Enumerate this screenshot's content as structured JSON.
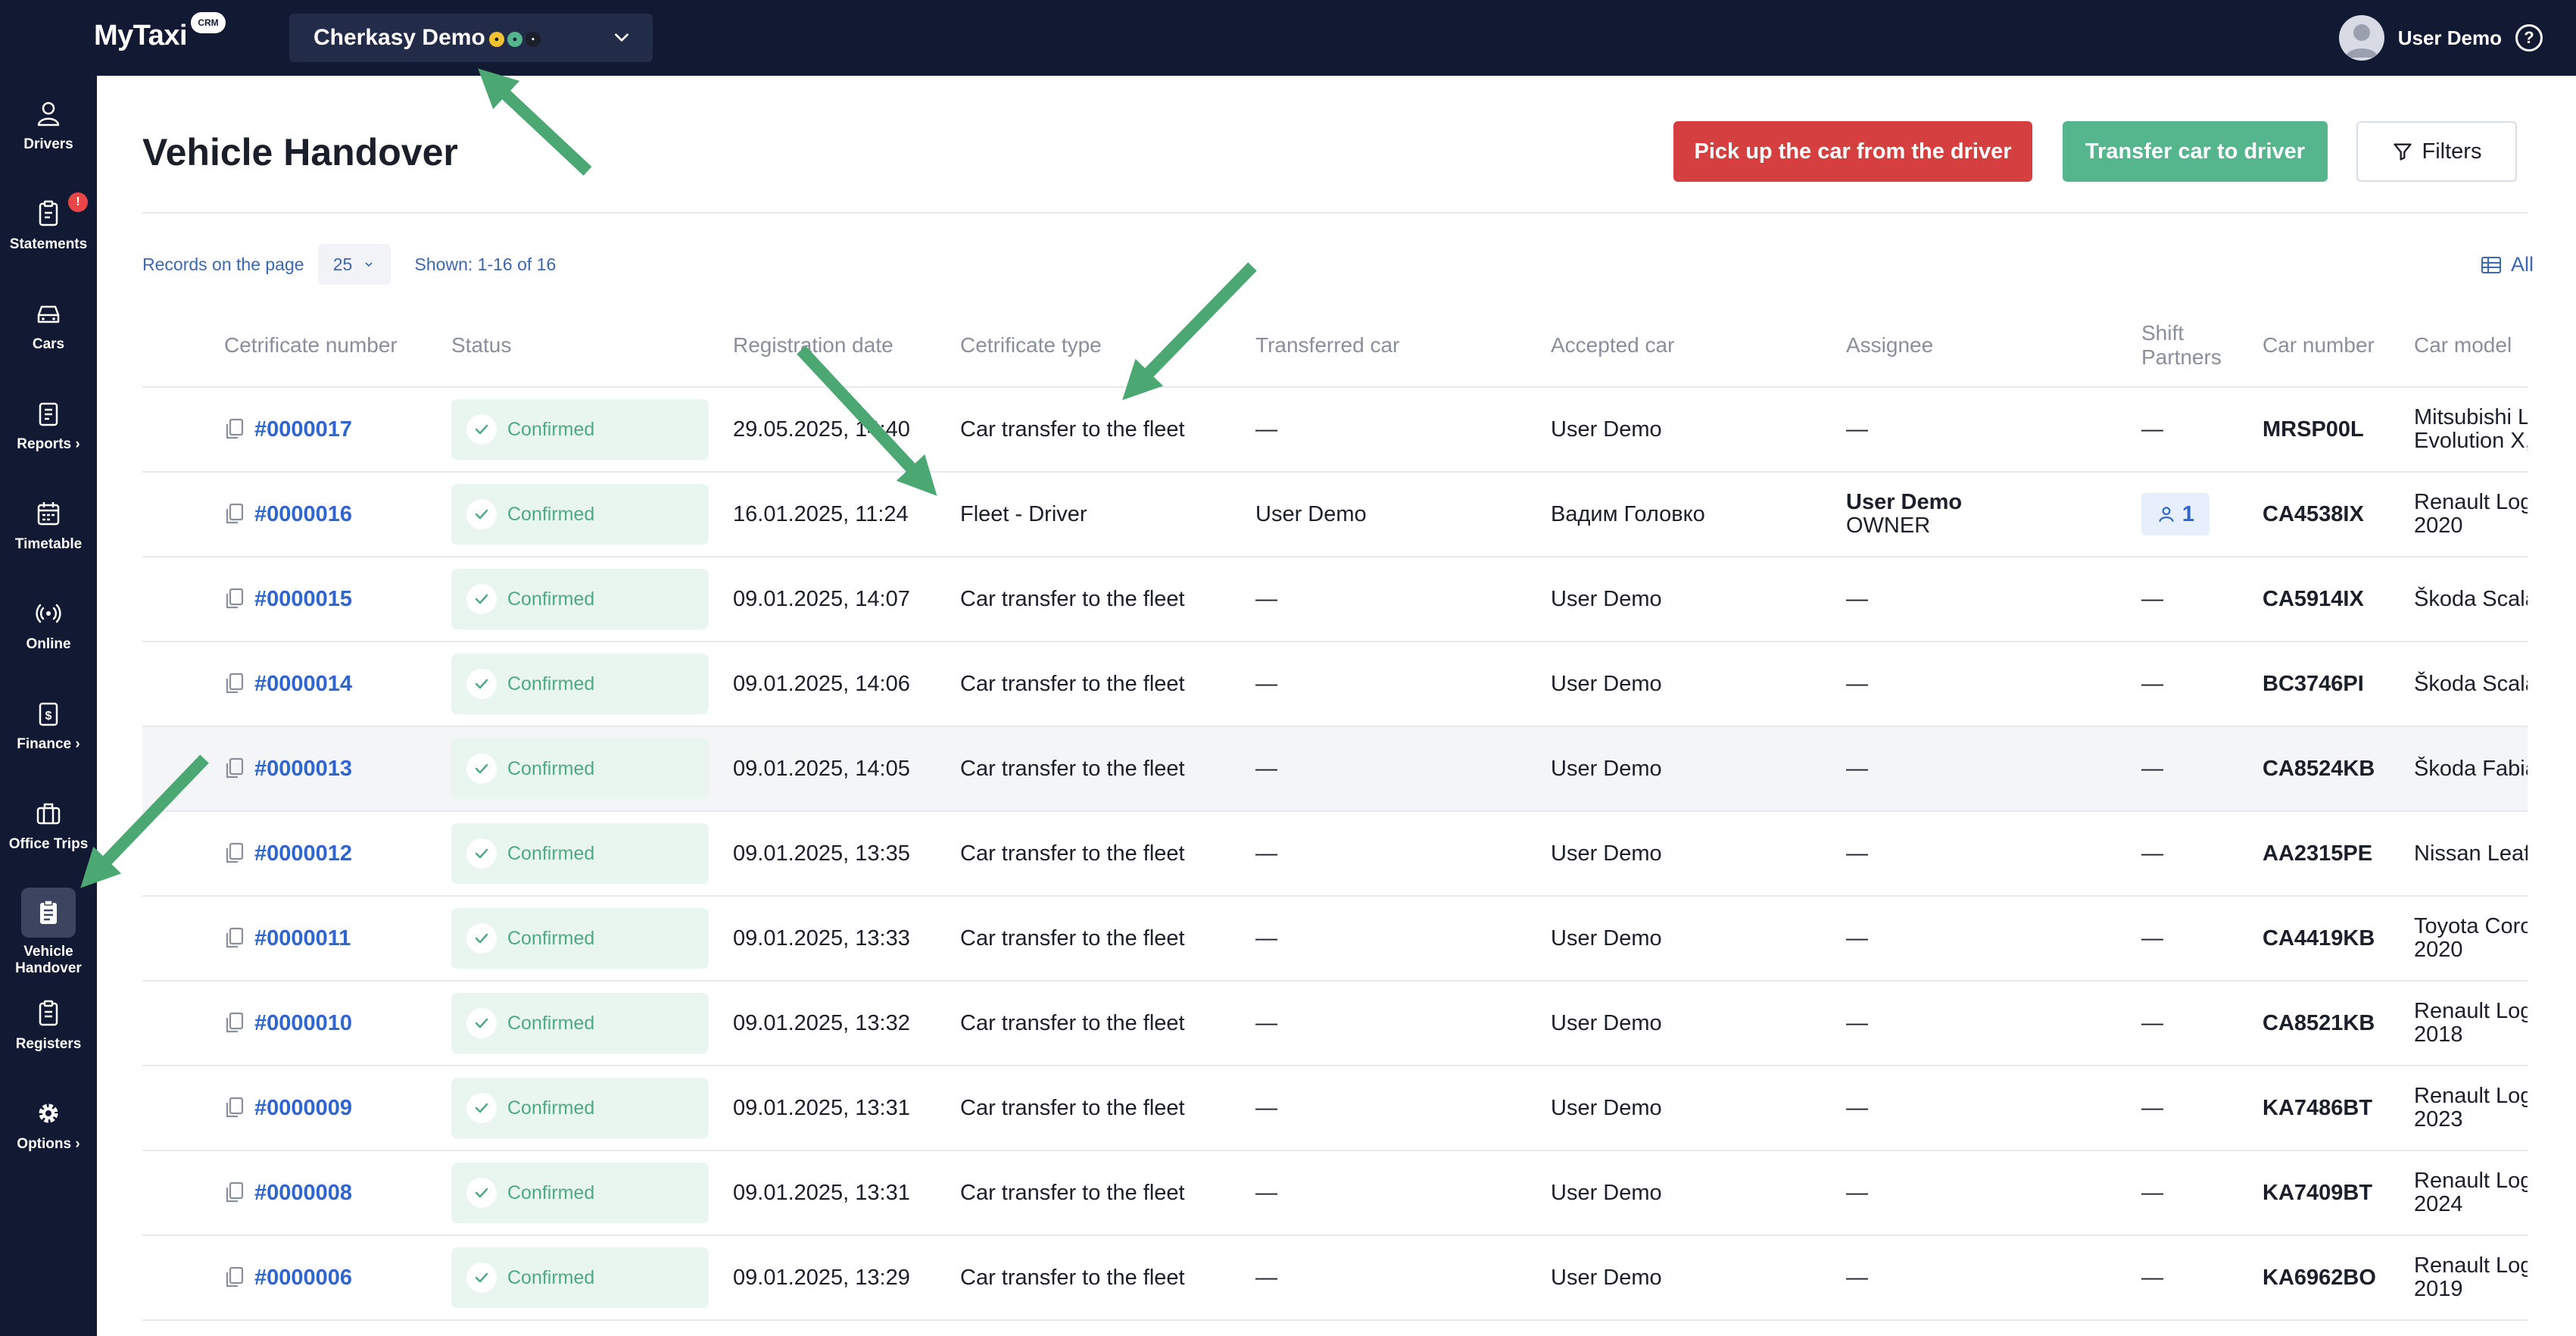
{
  "app": {
    "logo": "MyTaxi",
    "logo_badge": "CRM",
    "company": "Cherkasy Demo",
    "user": "User Demo",
    "help_glyph": "?"
  },
  "colors": {
    "sidebar_bg": "#121a33",
    "accent_blue": "#2f65cf",
    "danger": "#d63f3f",
    "success": "#55b58d",
    "arrow": "#4ca872"
  },
  "sidebar": {
    "items": [
      {
        "label": "Drivers",
        "icon": "person-icon"
      },
      {
        "label": "Statements",
        "icon": "clipboard-icon",
        "badge": "!"
      },
      {
        "label": "Cars",
        "icon": "car-icon"
      },
      {
        "label": "Reports ›",
        "icon": "report-icon"
      },
      {
        "label": "Timetable",
        "icon": "calendar-icon"
      },
      {
        "label": "Online",
        "icon": "broadcast-icon"
      },
      {
        "label": "Finance ›",
        "icon": "dollar-doc-icon"
      },
      {
        "label": "Office Trips",
        "icon": "briefcase-icon"
      },
      {
        "label": "Vehicle Handover",
        "icon": "handover-icon"
      },
      {
        "label": "Registers",
        "icon": "register-icon"
      },
      {
        "label": "Options ›",
        "icon": "gear-icon"
      }
    ]
  },
  "page": {
    "title": "Vehicle Handover",
    "btn_pickup": "Pick up the car from the driver",
    "btn_transfer": "Transfer car to driver",
    "btn_filters": "Filters",
    "records_label": "Records on the page",
    "per_page": "25",
    "shown": "Shown: 1-16 of 16",
    "all_link": "All"
  },
  "table": {
    "headers": {
      "cert_number": "Cetrificate number",
      "status": "Status",
      "reg_date": "Registration date",
      "cert_type": "Cetrificate type",
      "transferred": "Transferred car",
      "accepted": "Accepted car",
      "assignee": "Assignee",
      "shift_1": "Shift",
      "shift_2": "Partners",
      "car_number": "Car number",
      "car_model": "Car model"
    },
    "rows": [
      {
        "cert": "#0000017",
        "status": "Confirmed",
        "date": "29.05.2025, 14:40",
        "type": "Car transfer to the fleet",
        "transferred": "—",
        "accepted": "User Demo",
        "assignee": "—",
        "assignee_role": "",
        "partners": "—",
        "car": "MRSP00L",
        "model_1": "Mitsubishi L",
        "model_2": "Evolution X,"
      },
      {
        "cert": "#0000016",
        "status": "Confirmed",
        "date": "16.01.2025, 11:24",
        "type": "Fleet - Driver",
        "transferred": "User Demo",
        "accepted": "Вадим Головко",
        "assignee": "User Demo",
        "assignee_role": "OWNER",
        "partners": "1",
        "car": "CA4538IX",
        "model_1": "Renault Log",
        "model_2": "2020"
      },
      {
        "cert": "#0000015",
        "status": "Confirmed",
        "date": "09.01.2025, 14:07",
        "type": "Car transfer to the fleet",
        "transferred": "—",
        "accepted": "User Demo",
        "assignee": "—",
        "assignee_role": "",
        "partners": "—",
        "car": "CA5914IX",
        "model_1": "Škoda Scala",
        "model_2": ""
      },
      {
        "cert": "#0000014",
        "status": "Confirmed",
        "date": "09.01.2025, 14:06",
        "type": "Car transfer to the fleet",
        "transferred": "—",
        "accepted": "User Demo",
        "assignee": "—",
        "assignee_role": "",
        "partners": "—",
        "car": "BC3746PI",
        "model_1": "Škoda Scala",
        "model_2": ""
      },
      {
        "cert": "#0000013",
        "status": "Confirmed",
        "date": "09.01.2025, 14:05",
        "type": "Car transfer to the fleet",
        "transferred": "—",
        "accepted": "User Demo",
        "assignee": "—",
        "assignee_role": "",
        "partners": "—",
        "car": "CA8524KB",
        "model_1": "Škoda Fabia",
        "model_2": ""
      },
      {
        "cert": "#0000012",
        "status": "Confirmed",
        "date": "09.01.2025, 13:35",
        "type": "Car transfer to the fleet",
        "transferred": "—",
        "accepted": "User Demo",
        "assignee": "—",
        "assignee_role": "",
        "partners": "—",
        "car": "AA2315PE",
        "model_1": "Nissan Leaf",
        "model_2": ""
      },
      {
        "cert": "#0000011",
        "status": "Confirmed",
        "date": "09.01.2025, 13:33",
        "type": "Car transfer to the fleet",
        "transferred": "—",
        "accepted": "User Demo",
        "assignee": "—",
        "assignee_role": "",
        "partners": "—",
        "car": "CA4419KB",
        "model_1": "Toyota Coro",
        "model_2": "2020"
      },
      {
        "cert": "#0000010",
        "status": "Confirmed",
        "date": "09.01.2025, 13:32",
        "type": "Car transfer to the fleet",
        "transferred": "—",
        "accepted": "User Demo",
        "assignee": "—",
        "assignee_role": "",
        "partners": "—",
        "car": "CA8521KB",
        "model_1": "Renault Log",
        "model_2": "2018"
      },
      {
        "cert": "#0000009",
        "status": "Confirmed",
        "date": "09.01.2025, 13:31",
        "type": "Car transfer to the fleet",
        "transferred": "—",
        "accepted": "User Demo",
        "assignee": "—",
        "assignee_role": "",
        "partners": "—",
        "car": "KA7486BT",
        "model_1": "Renault Log",
        "model_2": "2023"
      },
      {
        "cert": "#0000008",
        "status": "Confirmed",
        "date": "09.01.2025, 13:31",
        "type": "Car transfer to the fleet",
        "transferred": "—",
        "accepted": "User Demo",
        "assignee": "—",
        "assignee_role": "",
        "partners": "—",
        "car": "KA7409BT",
        "model_1": "Renault Log",
        "model_2": "2024"
      },
      {
        "cert": "#0000006",
        "status": "Confirmed",
        "date": "09.01.2025, 13:29",
        "type": "Car transfer to the fleet",
        "transferred": "—",
        "accepted": "User Demo",
        "assignee": "—",
        "assignee_role": "",
        "partners": "—",
        "car": "KA6962BO",
        "model_1": "Renault Log",
        "model_2": "2019"
      }
    ]
  }
}
